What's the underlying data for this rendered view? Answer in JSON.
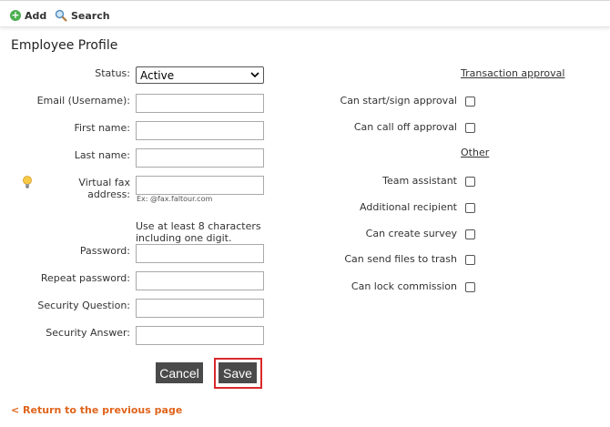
{
  "toolbar": {
    "add_label": "Add",
    "search_label": "Search"
  },
  "page_title": "Employee Profile",
  "form": {
    "status_label": "Status:",
    "status_value": "Active",
    "email_label": "Email (Username):",
    "first_name_label": "First name:",
    "last_name_label": "Last name:",
    "virtual_fax_label": "Virtual fax address:",
    "virtual_fax_hint": "Ex: @fax.faltour.com",
    "password_hint": "Use at least 8 characters including one digit.",
    "password_label": "Password:",
    "repeat_password_label": "Repeat password:",
    "security_question_label": "Security Question:",
    "security_answer_label": "Security Answer:"
  },
  "permissions": {
    "transaction_heading": "Transaction approval",
    "can_start_sign": "Can start/sign approval",
    "can_call_off": "Can call off approval",
    "other_heading": "Other",
    "team_assistant": "Team assistant",
    "additional_recipient": "Additional recipient",
    "can_create_survey": "Can create survey",
    "can_send_trash": "Can send files to trash",
    "can_lock_commission": "Can lock commission"
  },
  "buttons": {
    "cancel": "Cancel",
    "save": "Save"
  },
  "back_link": "< Return to the previous page",
  "colors": {
    "accent_orange": "#e0641c",
    "highlight_red": "#d9292b",
    "button_dark": "#4a4a4a",
    "add_green": "#4caf50"
  }
}
